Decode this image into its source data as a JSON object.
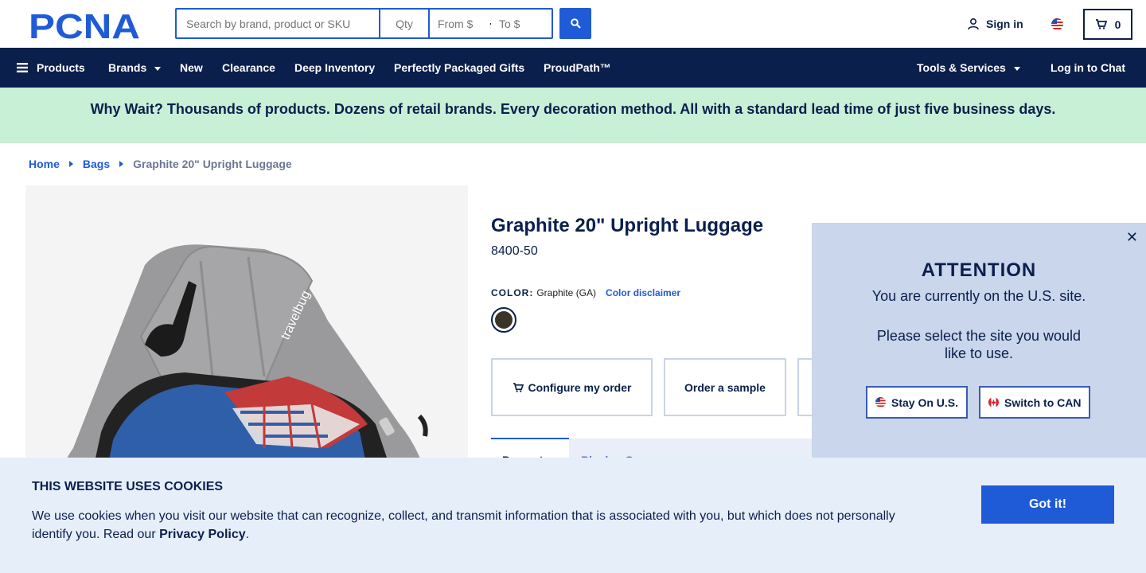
{
  "header": {
    "logo_text": "PCNA",
    "search_placeholder": "Search by brand, product or SKU",
    "qty_placeholder": "Qty",
    "price_from_placeholder": "From $",
    "price_to_placeholder": "To $",
    "signin_label": "Sign in",
    "cart_count": "0"
  },
  "nav": {
    "products": "Products",
    "brands": "Brands",
    "new": "New",
    "clearance": "Clearance",
    "deep_inventory": "Deep Inventory",
    "gifts": "Perfectly Packaged Gifts",
    "proudpath": "ProudPath™",
    "tools": "Tools & Services",
    "chat": "Log in to Chat"
  },
  "banner": {
    "text": "Why Wait? Thousands of products. Dozens of retail brands. Every decoration method. All with a standard lead time of just five business days."
  },
  "breadcrumb": {
    "home": "Home",
    "bags": "Bags",
    "current": "Graphite 20\" Upright Luggage"
  },
  "product": {
    "title": "Graphite 20\" Upright Luggage",
    "sku": "8400-50",
    "color_label": "COLOR:",
    "color_value": "Graphite (GA)",
    "color_disclaimer": "Color disclaimer",
    "swatch_color": "#3a3426",
    "image_brand_text": "travelbug",
    "configure_label": "Configure my order",
    "sample_label": "Order a sample",
    "tab_active": "Percent…",
    "tab_other": "Blank…   Specs…"
  },
  "site_selector": {
    "heading": "ATTENTION",
    "line1": "You are currently on the U.S. site.",
    "line2": "Please select the site you would like to use.",
    "stay_label": "Stay On U.S.",
    "switch_label": "Switch to CAN"
  },
  "cookie": {
    "title": "THIS WEBSITE USES COOKIES",
    "text": "We use cookies when you visit our website that can recognize, collect, and transmit information that is associated with you, but which does not personally identify you. Read our",
    "link": "Privacy Policy",
    "period": ".",
    "button": "Got it!"
  },
  "colors": {
    "navy": "#0b1f4d",
    "brand_blue": "#1f5bd6",
    "banner_green": "#c7f0d6",
    "modal_bg": "#c9d6eb",
    "cookie_bg": "#e6eef9"
  }
}
